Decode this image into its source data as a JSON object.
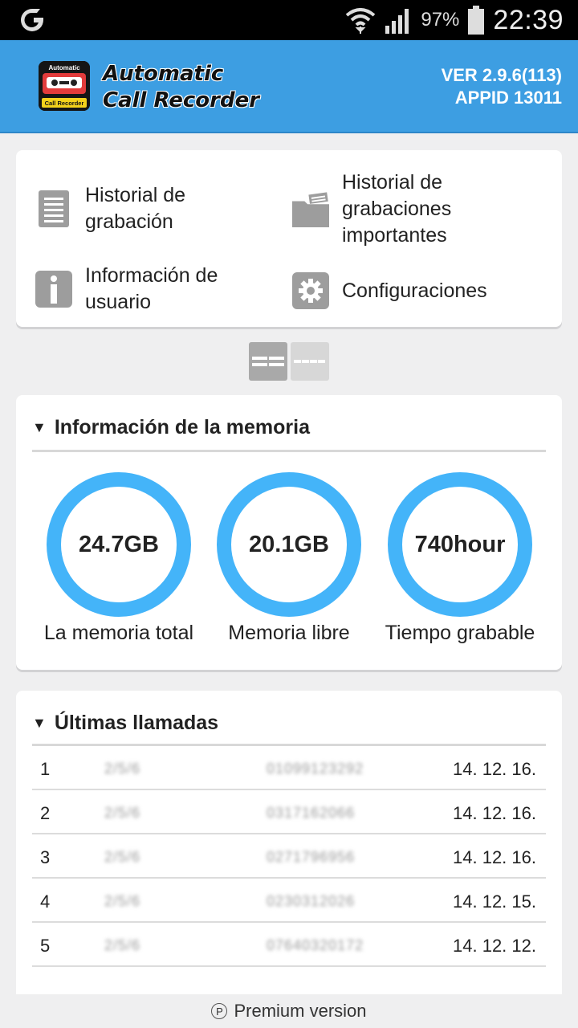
{
  "status_bar": {
    "battery_pct": "97%",
    "time": "22:39",
    "icons": [
      "carrier-icon",
      "wifi-icon",
      "signal-icon",
      "battery-icon"
    ]
  },
  "header": {
    "logo_text_top": "Automatic",
    "logo_text_bottom": "Call Recorder",
    "title_line1": "Automatic",
    "title_line2": "Call Recorder",
    "version": "VER 2.9.6(113)",
    "appid": "APPID 13011",
    "color": "#3d9ee2"
  },
  "menu": {
    "items": [
      {
        "label": "Historial de\ngrabación",
        "icon": "list-icon"
      },
      {
        "label": "Historial de\ngrabaciones\nimportantes",
        "icon": "folder-icon"
      },
      {
        "label": "Información de\nusuario",
        "icon": "info-icon"
      },
      {
        "label": "Configuraciones",
        "icon": "gear-icon"
      }
    ]
  },
  "memory": {
    "title": "Información de la memoria",
    "ring_color": "#44b4f9",
    "stats": [
      {
        "value": "24.7GB",
        "label": "La memoria total"
      },
      {
        "value": "20.1GB",
        "label": "Memoria libre"
      },
      {
        "value": "740hour",
        "label": "Tiempo grabable"
      }
    ]
  },
  "calls": {
    "title": "Últimas llamadas",
    "rows": [
      {
        "idx": "1",
        "name": "2/5/6",
        "number": "01099123292",
        "date": "14. 12. 16."
      },
      {
        "idx": "2",
        "name": "2/5/6",
        "number": "0317162066",
        "date": "14. 12. 16."
      },
      {
        "idx": "3",
        "name": "2/5/6",
        "number": "0271796956",
        "date": "14. 12. 16."
      },
      {
        "idx": "4",
        "name": "2/5/6",
        "number": "0230312026",
        "date": "14. 12. 15."
      },
      {
        "idx": "5",
        "name": "2/5/6",
        "number": "07640320172",
        "date": "14. 12. 12."
      }
    ]
  },
  "footer": {
    "label": "Premium version",
    "mark": "P"
  }
}
